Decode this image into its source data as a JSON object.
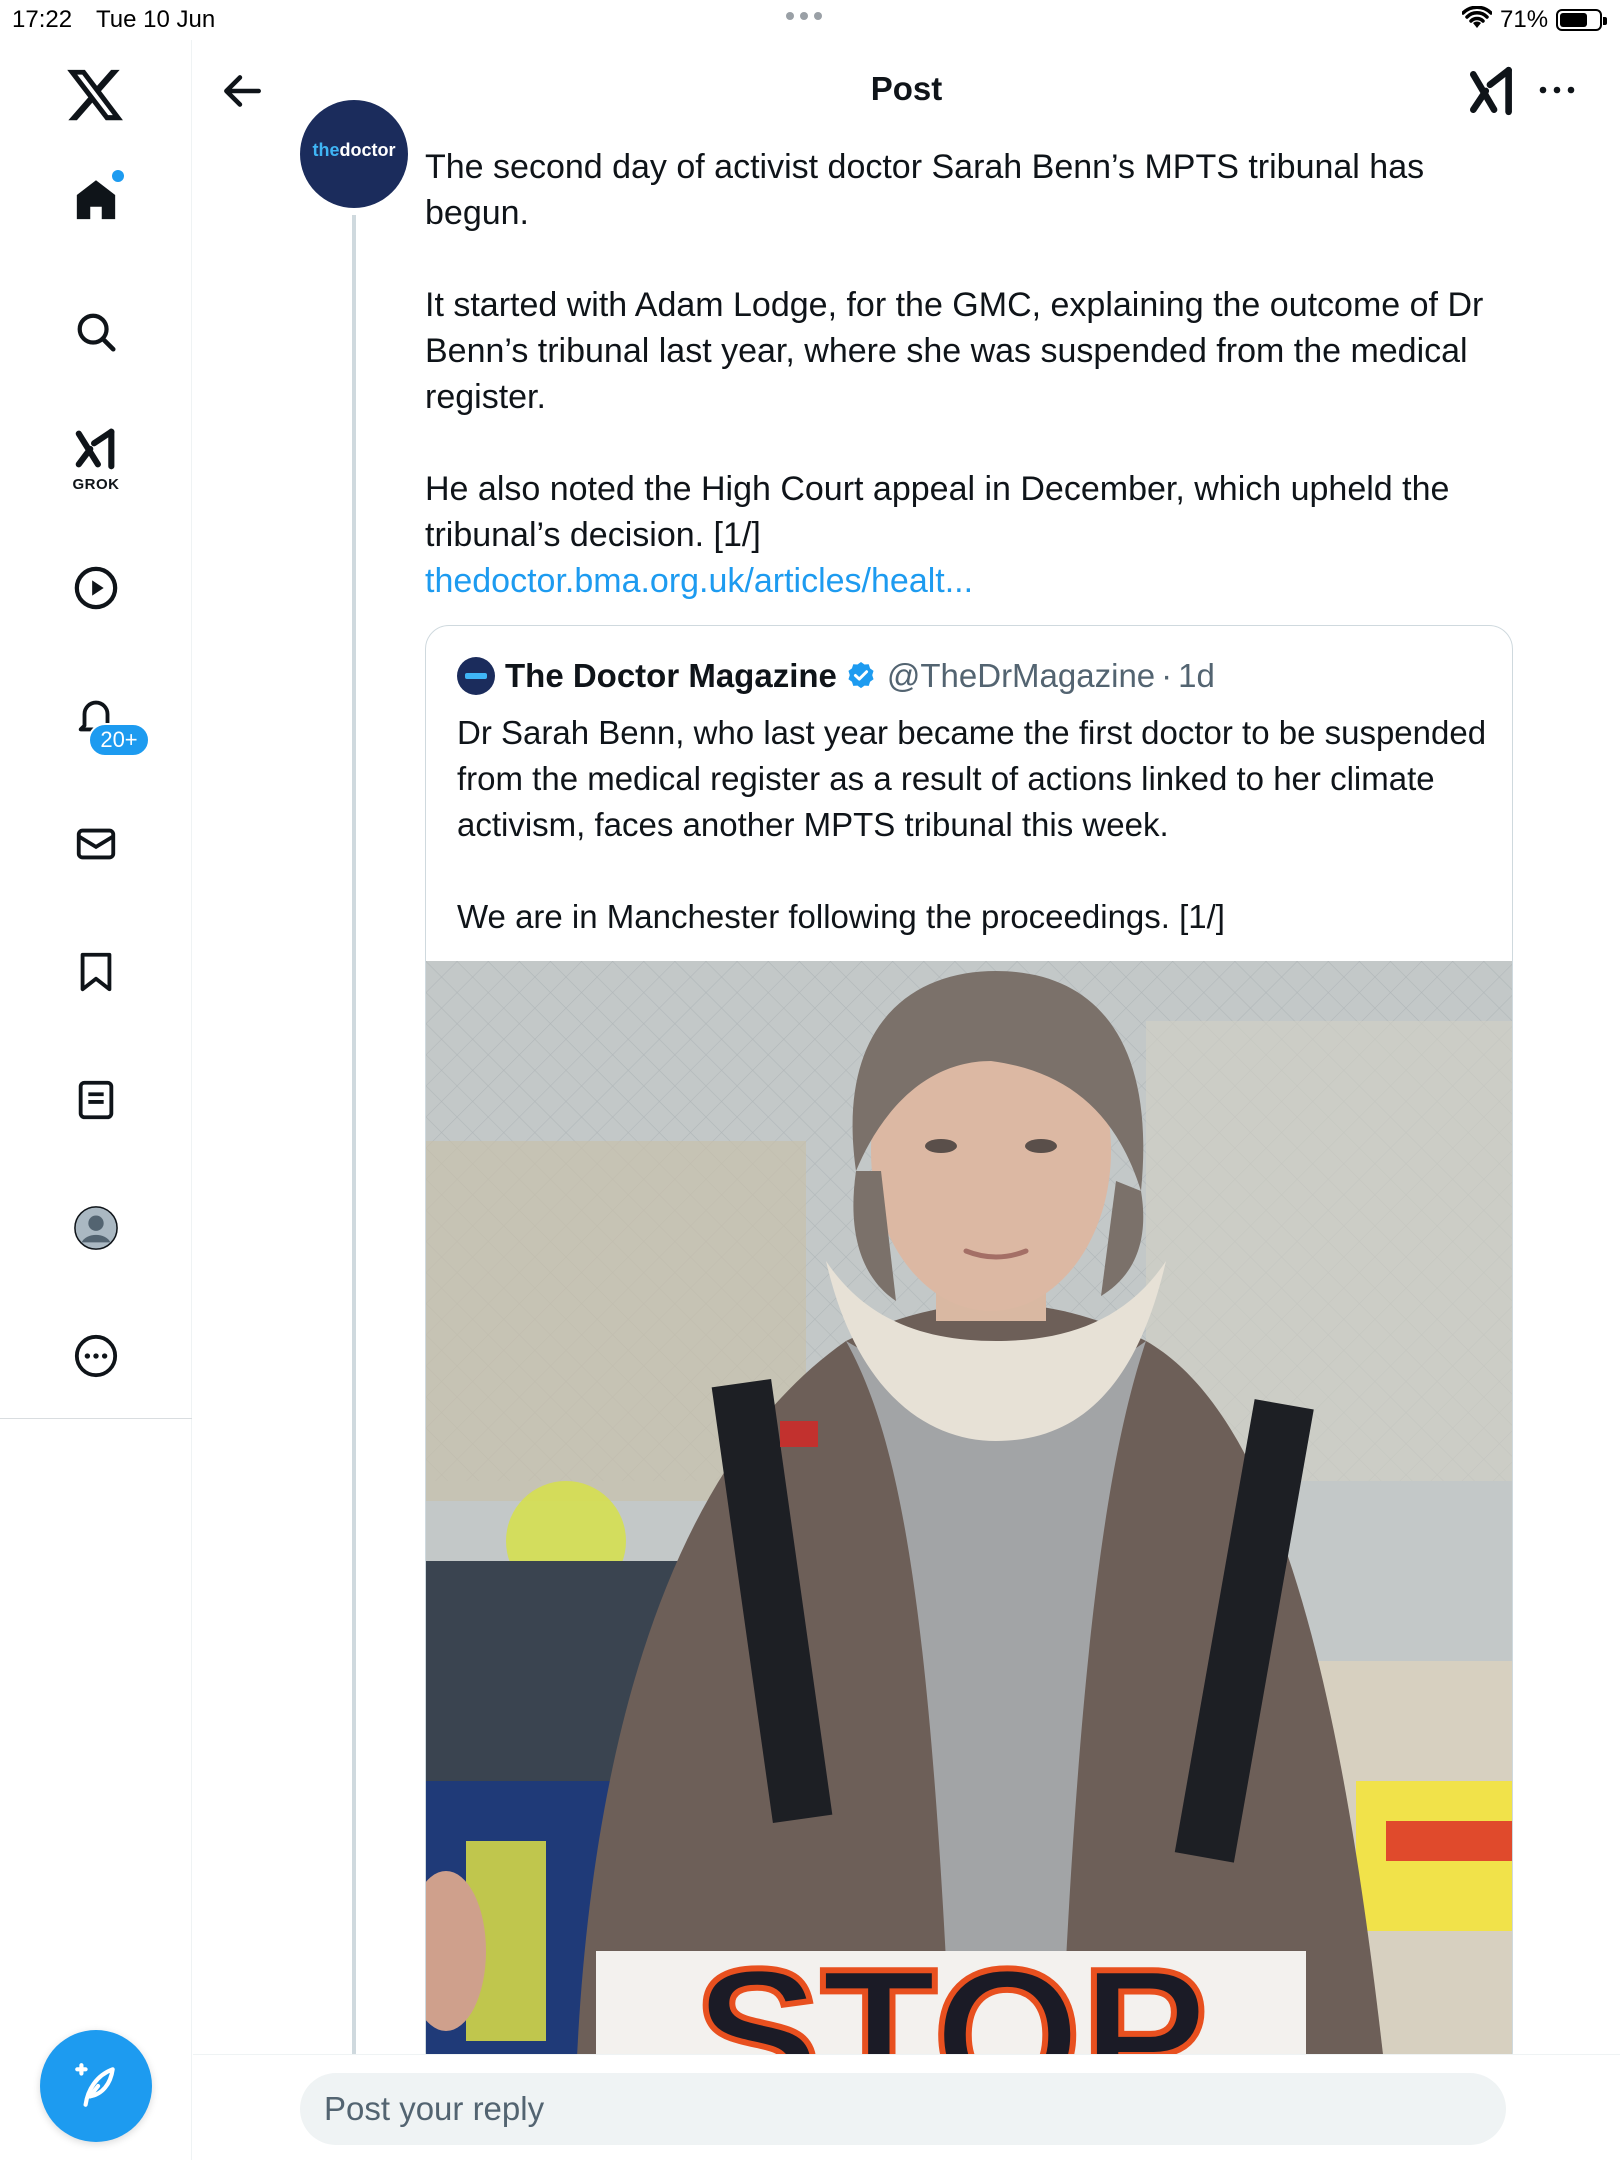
{
  "status_bar": {
    "time": "17:22",
    "date": "Tue 10 Jun",
    "battery_percent": "71%",
    "battery_level": 0.71
  },
  "nav": {
    "grok_label": "GROK",
    "notifications_badge": "20+",
    "accent_color": "#1d9bf0"
  },
  "header": {
    "title": "Post"
  },
  "post": {
    "avatar_text_a": "the",
    "avatar_text_b": "doctor",
    "paragraph_1": "The second day of activist doctor Sarah Benn’s MPTS tribunal has begun.",
    "paragraph_2": "It started with Adam Lodge, for the GMC, explaining the outcome of Dr Benn’s tribunal last year, where she was suspended from the medical register.",
    "paragraph_3": "He also noted the High Court appeal in December, which upheld the tribunal’s decision. [1/]",
    "link": "thedoctor.bma.org.uk/articles/healt..."
  },
  "quote": {
    "name": "The Doctor Magazine",
    "handle": "@TheDrMagazine",
    "separator": "·",
    "age": "1d",
    "paragraph_1": "Dr Sarah Benn, who last year became the first doctor to be suspended from the medical register as a result of actions linked to her climate activism, faces another MPTS tribunal this week.",
    "paragraph_2": "We are in Manchester following the proceedings. [1/]",
    "sign_text": "STOP"
  },
  "reply": {
    "placeholder": "Post your reply"
  }
}
